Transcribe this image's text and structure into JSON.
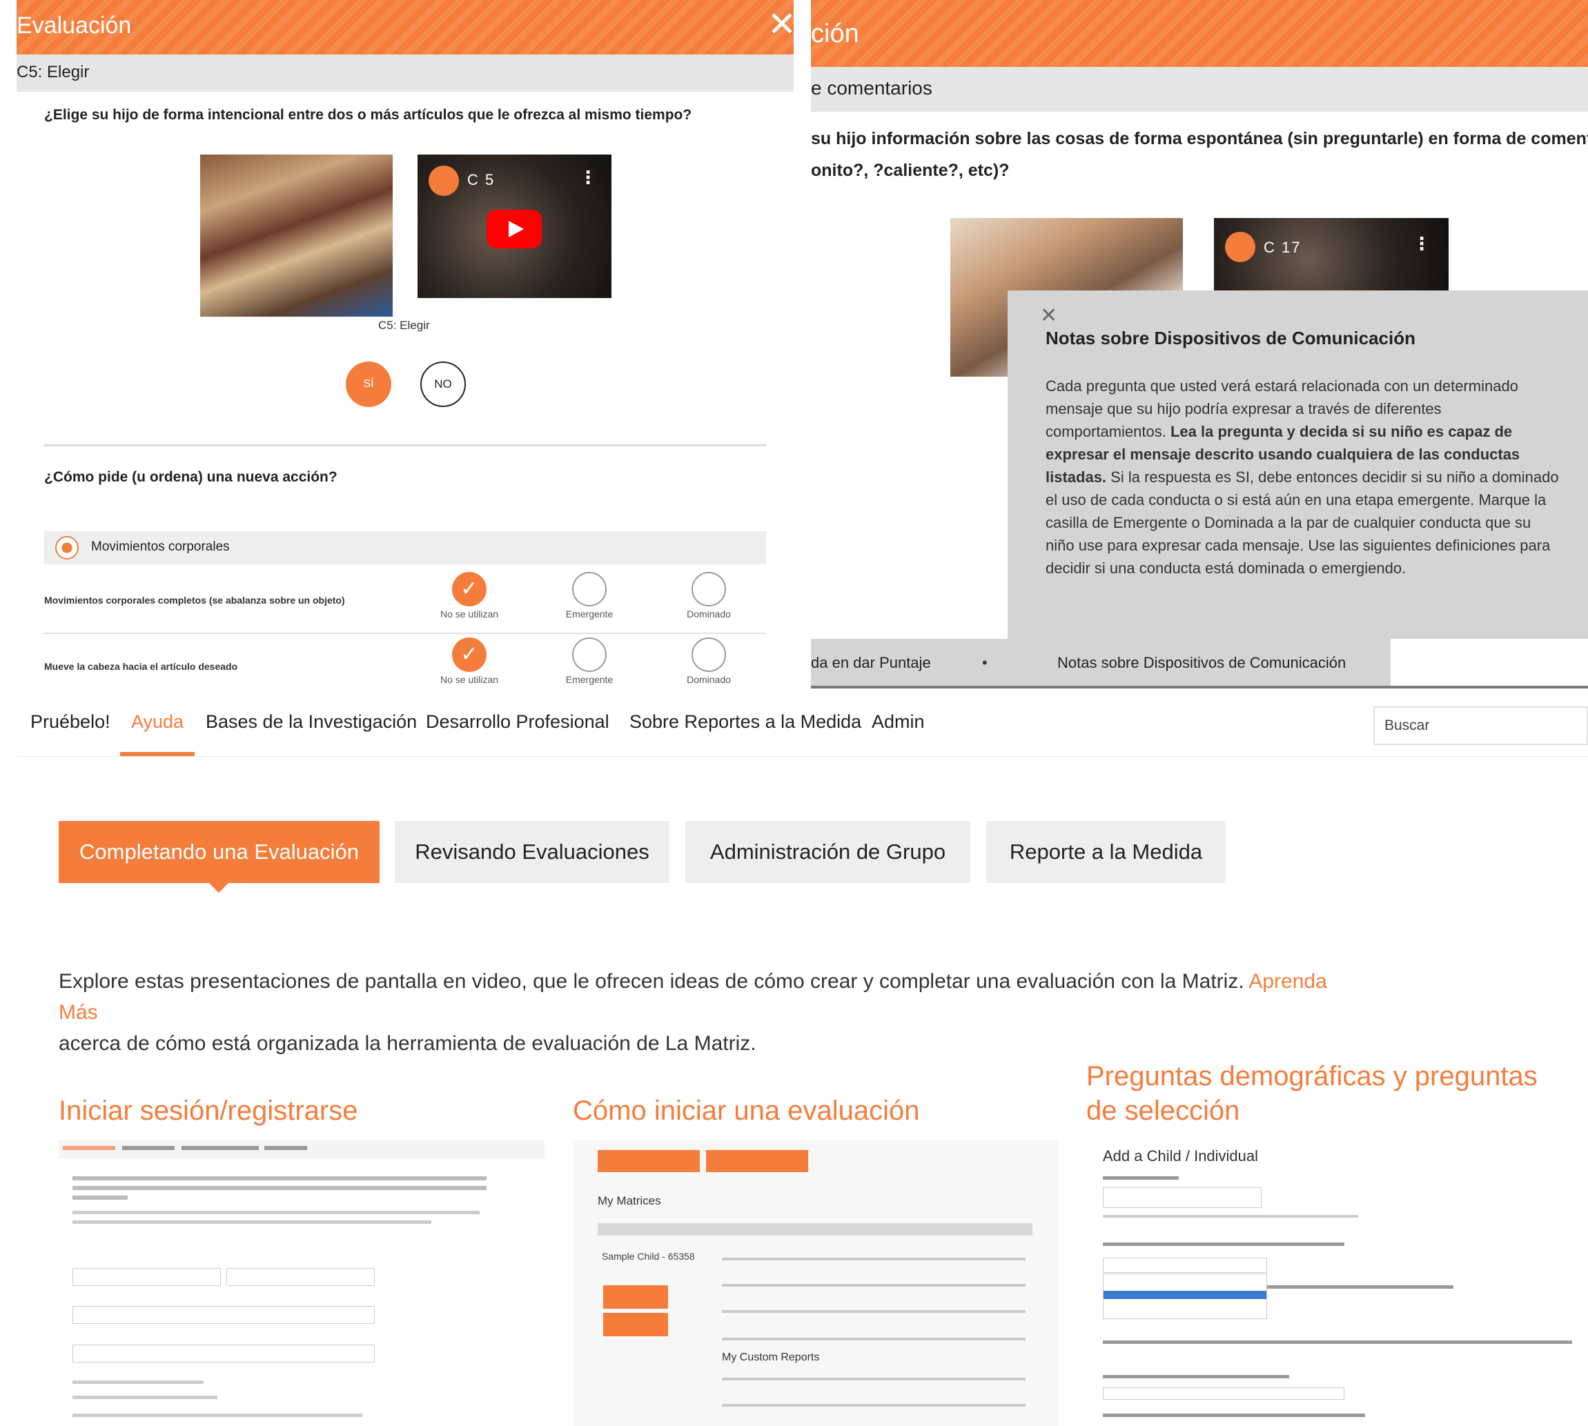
{
  "panel1": {
    "title": "Evaluación",
    "close": "✕",
    "subheader": "C5: Elegir",
    "question": "¿Elige su hijo de forma intencional entre dos o más artículos que le ofrezca al mismo tiempo?",
    "video_label": "C 5",
    "caption": "C5: Elegir",
    "btn_yes": "SÍ",
    "btn_no": "NO",
    "question2": "¿Cómo pide (u ordena) una nueva acción?",
    "category": "Movimientos corporales",
    "rows": [
      {
        "text": "Movimientos corporales completos (se abalanza sobre un objeto)"
      },
      {
        "text": "Mueve la cabeza hacia el artículo deseado"
      }
    ],
    "options": [
      "No se utilizan",
      "Emergente",
      "Dominado"
    ]
  },
  "panel2": {
    "title": "ción",
    "subheader": "e comentarios",
    "question_line1": "su hijo información sobre las cosas de forma espontánea (sin preguntarle) en forma de comentarios",
    "question_line2": "onito?, ?caliente?, etc)?",
    "video_label": "C 17",
    "modal_close": "✕",
    "modal_title": "Notas sobre Dispositivos de Comunicación",
    "modal_body_1": "Cada pregunta que usted verá estará relacionada con un determinado mensaje que su hijo podría expresar a través de diferentes comportamientos. ",
    "modal_body_bold": "Lea la pregunta y decida si su niño es capaz de expresar el mensaje descrito usando cualquiera de las conductas listadas.",
    "modal_body_2": " Si la respuesta es SI, debe entonces decidir si su niño a dominado el uso de cada conducta o si está aún en una etapa emergente. Marque la casilla de Emergente o Dominada a la par de cualquier conducta que su niño use para expresar cada mensaje. Use las siguientes definiciones para decidir si una conducta está dominada o emergiendo.",
    "tab_left": "da en dar Puntaje",
    "tab_right": "Notas sobre Dispositivos de Comunicación"
  },
  "panel3": {
    "nav": [
      "Pruébelo!",
      "Ayuda",
      "Bases de la Investigación",
      "Desarrollo Profesional",
      "Sobre Reportes a la Medida",
      "Admin"
    ],
    "search_placeholder": "Buscar",
    "tabs": [
      "Completando una Evaluación",
      "Revisando Evaluaciones",
      "Administración de Grupo",
      "Reporte a la Medida"
    ],
    "intro_text": "Explore estas presentaciones de pantalla en video, que le ofrecen ideas de cómo crear y completar una evaluación con la Matriz. ",
    "intro_link": "Aprenda Más",
    "intro_text2": "acerca de cómo está organizada la herramienta de evaluación de La Matriz.",
    "sections": [
      {
        "title": "Iniciar sesión/registrarse"
      },
      {
        "title": "Cómo iniciar una evaluación"
      },
      {
        "title": "Preguntas demográficas y preguntas de selección"
      }
    ],
    "thumb2_heading": "My Matrices",
    "thumb2_child": "Sample Child - 65358",
    "thumb2_reports": "My Custom Reports",
    "thumb3_heading": "Add a Child / Individual"
  },
  "colors": {
    "accent": "#f47d3c",
    "panel_gray": "#e6e6e6",
    "modal_gray": "#d4d4d4"
  }
}
